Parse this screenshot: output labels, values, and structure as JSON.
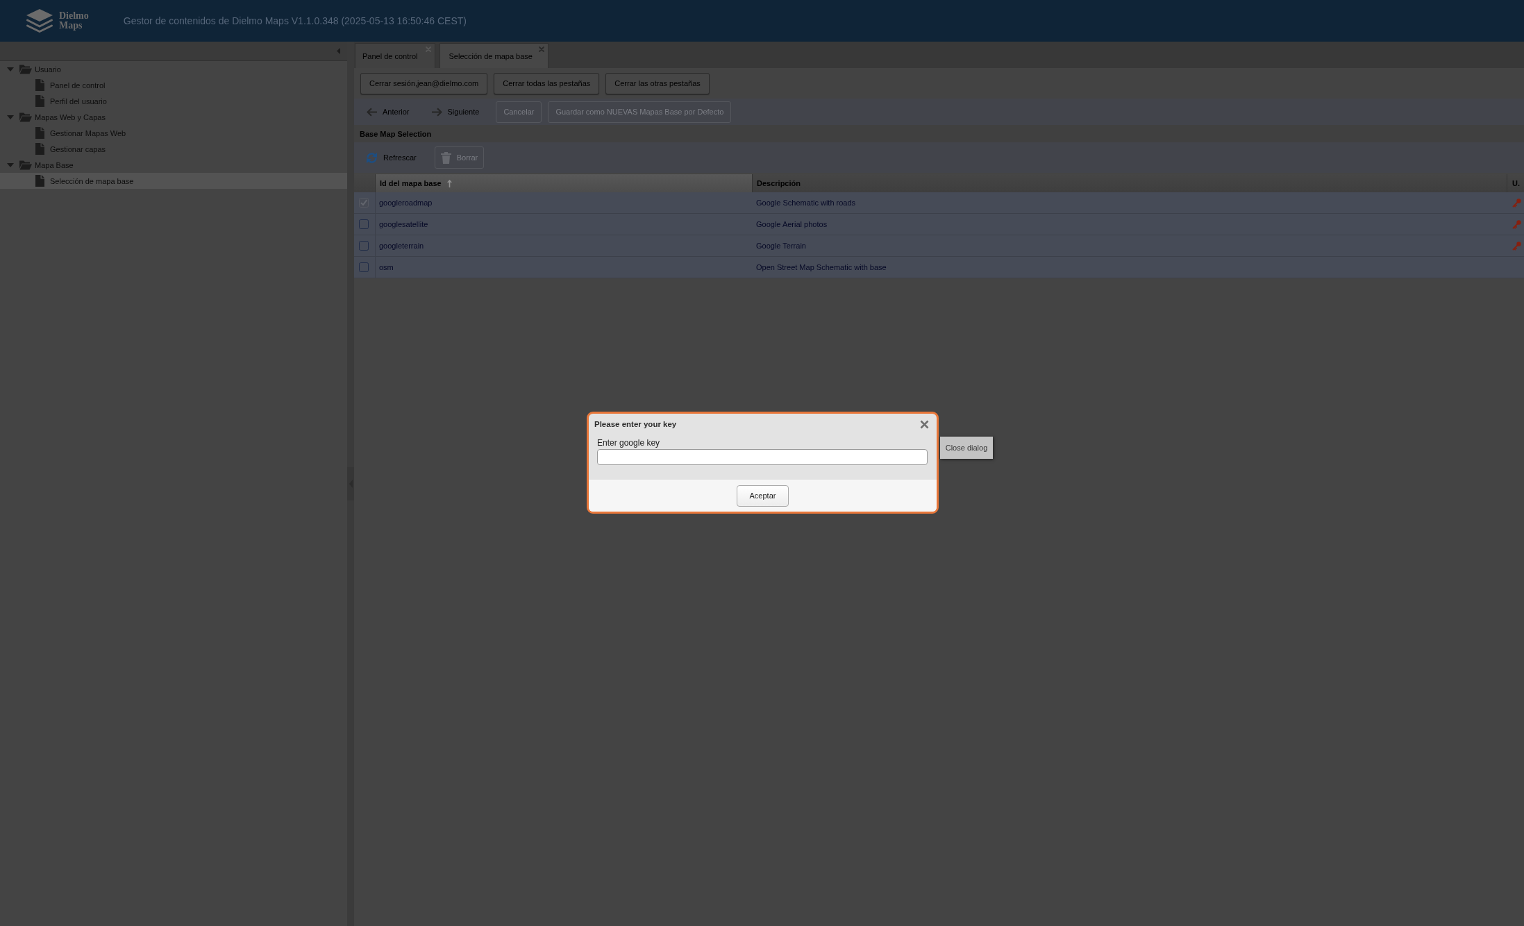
{
  "header": {
    "logo_text": "Dielmo Maps",
    "title": "Gestor de contenidos de Dielmo Maps V1.1.0.348 (2025-05-13 16:50:46 CEST)"
  },
  "sidebar": {
    "tree": [
      {
        "label": "Usuario",
        "expanded": true,
        "selected": false,
        "children": [
          {
            "label": "Panel de control",
            "selected": false
          },
          {
            "label": "Perfil del usuario",
            "selected": false
          }
        ]
      },
      {
        "label": "Mapas Web y Capas",
        "expanded": true,
        "selected": false,
        "children": [
          {
            "label": "Gestionar Mapas Web",
            "selected": false
          },
          {
            "label": "Gestionar capas",
            "selected": false
          }
        ]
      },
      {
        "label": "Mapa Base",
        "expanded": true,
        "selected": false,
        "children": [
          {
            "label": "Selección de mapa base",
            "selected": true
          }
        ]
      }
    ]
  },
  "tabs": [
    {
      "label": "Panel de control",
      "selected": false,
      "closable": true
    },
    {
      "label": "Selección de mapa base",
      "selected": true,
      "closable": true
    }
  ],
  "session_buttons": [
    "Cerrar sesión,jean@dielmo.com",
    "Cerrar todas las pestañas",
    "Cerrar las otras pestañas"
  ],
  "wizard_toolbar": [
    {
      "kind": "back",
      "label": "Anterior",
      "disabled": false
    },
    {
      "kind": "next",
      "label": "Siguiente",
      "disabled": false
    },
    {
      "kind": "button",
      "label": "Cancelar",
      "disabled": true
    },
    {
      "kind": "button",
      "label": "Guardar como NUEVAS Mapas Base por Defecto",
      "disabled": true
    }
  ],
  "panel": {
    "title": "Base Map Selection",
    "toolbar": [
      {
        "kind": "refresh",
        "label": "Refrescar",
        "disabled": false
      },
      {
        "kind": "delete",
        "label": "Borrar",
        "disabled": true
      }
    ],
    "table": {
      "columns": [
        {
          "label": "Id del mapa base",
          "sorted": true
        },
        {
          "label": "Descripción",
          "sorted": false
        },
        {
          "label": "U.",
          "sorted": false
        }
      ],
      "rows": [
        {
          "checked": true,
          "id": "googleroadmap",
          "description": "Google Schematic with roads",
          "key": true
        },
        {
          "checked": false,
          "id": "googlesatellite",
          "description": "Google Aerial photos",
          "key": true
        },
        {
          "checked": false,
          "id": "googleterrain",
          "description": "Google Terrain",
          "key": true
        },
        {
          "checked": false,
          "id": "osm",
          "description": "Open Street Map Schematic with base",
          "key": false
        }
      ]
    }
  },
  "dialog": {
    "title": "Please enter your key",
    "field_label": "Enter google key",
    "buttons": [
      "Aceptar"
    ],
    "close_hint": "Close dialog"
  }
}
